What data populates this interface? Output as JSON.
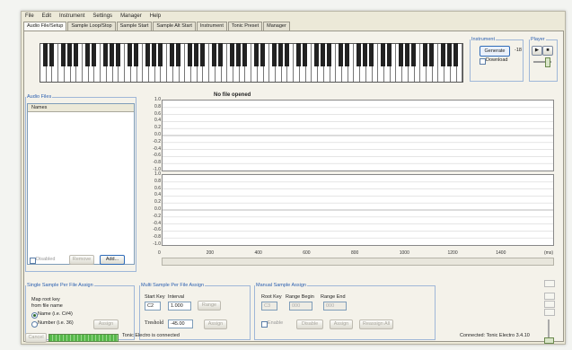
{
  "menu": [
    "File",
    "Edit",
    "Instrument",
    "Settings",
    "Manager",
    "Help"
  ],
  "tabs": [
    "Audio File/Setup",
    "Sample Loop/Stop",
    "Sample Start",
    "Sample Alt Start",
    "Instrument",
    "Tonic Preset",
    "Manager"
  ],
  "instrument": {
    "legend": "Instrument",
    "generate": "Generate",
    "download": "Download",
    "readout": "-18"
  },
  "player": {
    "legend": "Player"
  },
  "audio_files": {
    "legend": "Audio Files",
    "column": "Names",
    "disabled_label": "Disabled",
    "remove": "Remove",
    "add": "Add..."
  },
  "waveform": {
    "title": "No file opened",
    "yticks": [
      "1.0",
      "0.8",
      "0.6",
      "0.4",
      "0.2",
      "0.0",
      "-0.2",
      "-0.4",
      "-0.6",
      "-0.8",
      "-1.0"
    ],
    "xticks": [
      "0",
      "200",
      "400",
      "600",
      "800",
      "1000",
      "1200",
      "1400",
      "(ms)"
    ]
  },
  "single_assign": {
    "legend": "Single Sample Per File Assign",
    "line1": "Map root key",
    "line2": "from file name",
    "opt1": "Name (i.e. C#4)",
    "opt2": "Number (i.e. 36)",
    "button": "Assign"
  },
  "multi_assign": {
    "legend": "Multi Sample Per File Assign",
    "start_label": "Start Key",
    "interval_label": "Interval",
    "start_value": "C2",
    "interval_value": "1.000",
    "range_btn": "Range",
    "threshold_label": "Treshold",
    "threshold_value": "-45.00",
    "assign": "Assign"
  },
  "manual_assign": {
    "legend": "Manual Sample Assign",
    "root_label": "Root Key",
    "begin_label": "Range Begin",
    "end_label": "Range End",
    "root_value": "C3",
    "begin_value": "000",
    "end_value": "000",
    "enable": "Enable",
    "disable": "Disable",
    "assign": "Assign",
    "reassign": "Reassign All"
  },
  "status": {
    "cancel": "Cancel",
    "message": "Tonic Electro is connected",
    "right": "Connected: Tonic Electro 3.4.10"
  }
}
